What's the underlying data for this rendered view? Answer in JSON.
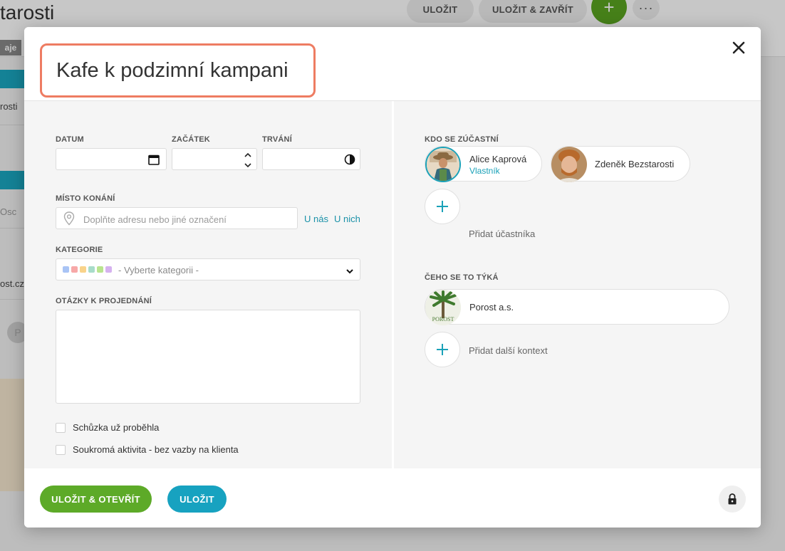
{
  "background": {
    "page_title_fragment": "tarosti",
    "save_label": "ULOŽIT",
    "save_close_label": "ULOŽIT & ZAVŘÍT",
    "plus_label": "+",
    "more_label": "···",
    "tag_fragment": "aje",
    "row1_fragment": "rosti",
    "row2_fragment": "Osc",
    "row3_fragment": "ost.cz",
    "row4_fragment": "P"
  },
  "modal": {
    "title": "Kafe k podzimní kampani",
    "fields": {
      "date_label": "DATUM",
      "start_label": "ZAČÁTEK",
      "duration_label": "TRVÁNÍ",
      "place_label": "MÍSTO KONÁNÍ",
      "place_placeholder": "Doplňte adresu nebo jiné označení",
      "place_link_us": "U nás",
      "place_link_them": "U nich",
      "category_label": "KATEGORIE",
      "category_placeholder": "- Vyberte kategorii -",
      "category_colors": [
        "#a9c4f5",
        "#f7a8a8",
        "#f9d38a",
        "#a8dcc9",
        "#b9e48f",
        "#d5b2ef"
      ],
      "questions_label": "OTÁZKY K PROJEDNÁNÍ",
      "questions_value": ""
    },
    "checkboxes": [
      {
        "label": "Schůzka už proběhla",
        "checked": false
      },
      {
        "label": "Soukromá aktivita - bez vazby na klienta",
        "checked": false
      }
    ],
    "participants": {
      "label": "KDO SE ZÚČASTNÍ",
      "people": [
        {
          "name": "Alice Kaprová",
          "role": "Vlastník"
        },
        {
          "name": "Zdeněk Bezstarosti",
          "role": ""
        }
      ],
      "add_label": "Přidat účastníka"
    },
    "context": {
      "label": "ČEHO SE TO TÝKÁ",
      "items": [
        {
          "name": "Porost a.s.",
          "logo_text": "POROST"
        }
      ],
      "add_label": "Přidat další kontext"
    },
    "footer": {
      "save_open_label": "ULOŽIT & OTEVŘÍT",
      "save_label": "ULOŽIT"
    },
    "colors": {
      "title_border": "#ee7c62",
      "primary_green": "#5daa28",
      "primary_teal": "#17a2c0",
      "link": "#1a91a8"
    }
  }
}
